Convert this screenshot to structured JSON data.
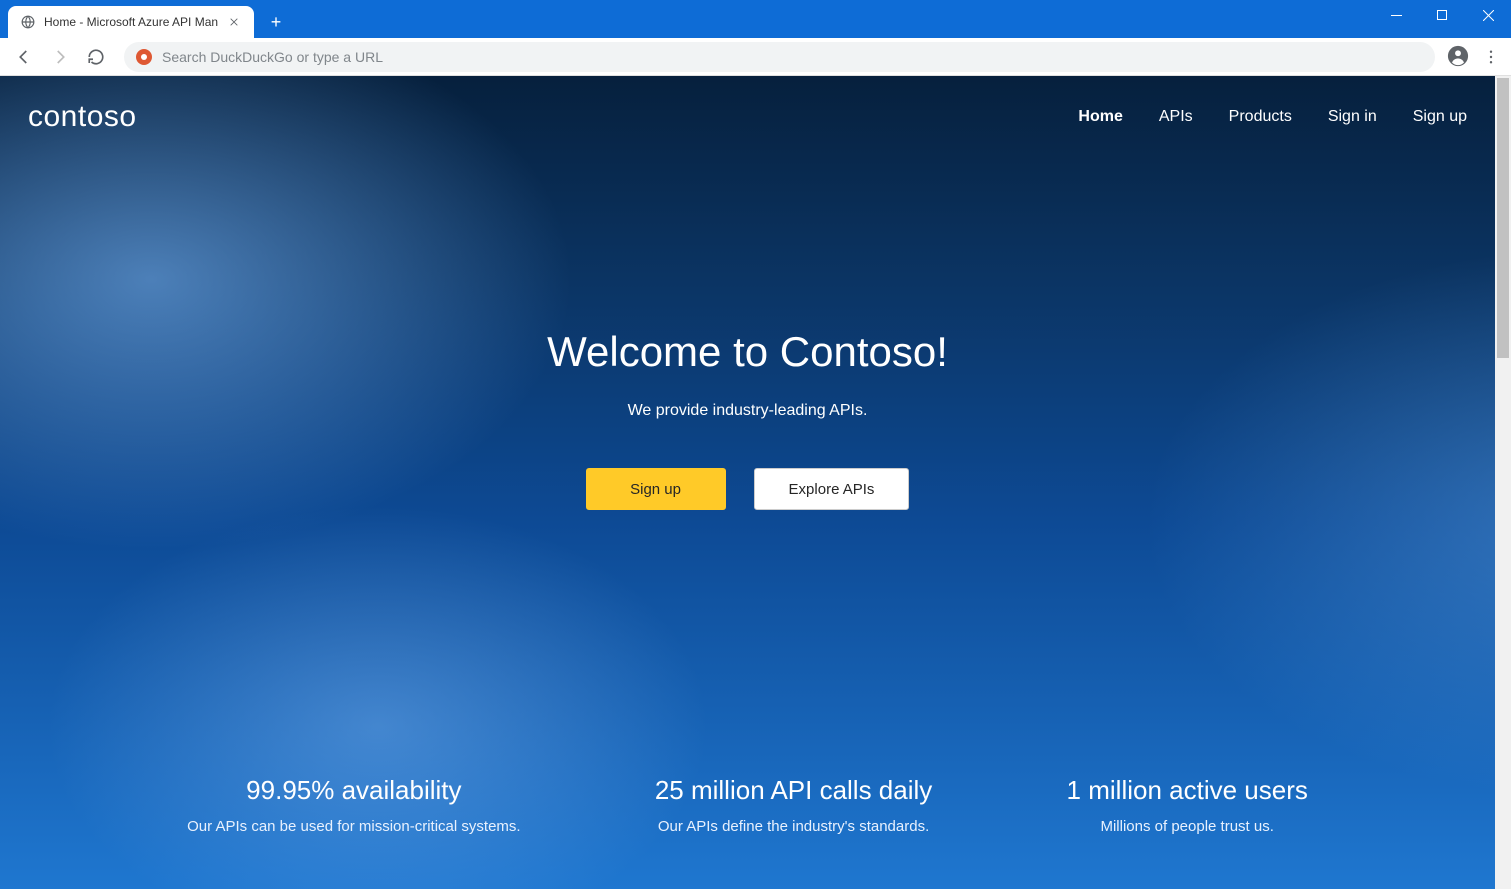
{
  "browser": {
    "tab_title": "Home - Microsoft Azure API Man",
    "address_placeholder": "Search DuckDuckGo or type a URL"
  },
  "site": {
    "logo": "contoso",
    "nav": {
      "home": "Home",
      "apis": "APIs",
      "products": "Products",
      "signin": "Sign in",
      "signup": "Sign up"
    }
  },
  "hero": {
    "title": "Welcome to Contoso!",
    "subtitle": "We provide industry-leading APIs.",
    "primary_btn": "Sign up",
    "secondary_btn": "Explore APIs"
  },
  "stats": [
    {
      "title": "99.95% availability",
      "sub": "Our APIs can be used for mission-critical systems."
    },
    {
      "title": "25 million API calls daily",
      "sub": "Our APIs define the industry's standards."
    },
    {
      "title": "1 million active users",
      "sub": "Millions of people trust us."
    }
  ]
}
